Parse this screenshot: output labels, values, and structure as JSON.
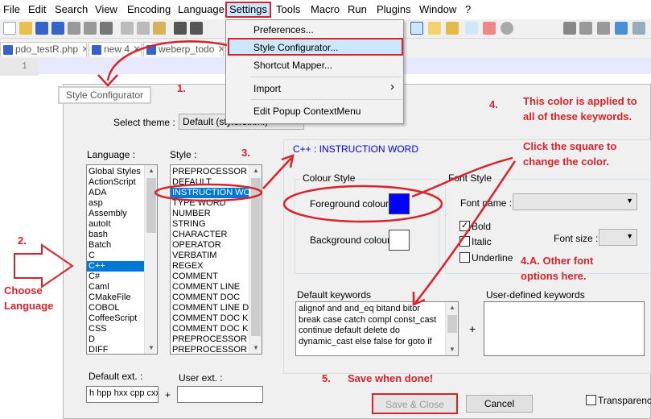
{
  "menubar": {
    "items": [
      "File",
      "Edit",
      "Search",
      "View",
      "Encoding",
      "Language",
      "Settings",
      "Tools",
      "Macro",
      "Run",
      "Plugins",
      "Window",
      "?"
    ]
  },
  "tabs": [
    {
      "label": "pdo_testR.php",
      "close": "✕"
    },
    {
      "label": "new 4",
      "close": "✕"
    },
    {
      "label": "weberp_todo",
      "close": "✕"
    }
  ],
  "editor": {
    "line_number": "1"
  },
  "settings_menu": {
    "items": [
      "Preferences...",
      "Style Configurator...",
      "Shortcut Mapper...",
      "Import",
      "Edit Popup ContextMenu"
    ],
    "submenu_arrow": "›"
  },
  "dialog": {
    "title": "Style Configurator",
    "select_theme_label": "Select theme :",
    "theme_value": "Default (stylers.xml)",
    "language_label": "Language :",
    "style_label": "Style :",
    "languages": [
      "Global Styles",
      "ActionScript",
      "ADA",
      "asp",
      "Assembly",
      "autoIt",
      "bash",
      "Batch",
      "C",
      "C++",
      "C#",
      "Caml",
      "CMakeFile",
      "COBOL",
      "CoffeeScript",
      "CSS",
      "D",
      "DIFF"
    ],
    "selected_language": "C++",
    "styles": [
      "PREPROCESSOR",
      "DEFAULT",
      "INSTRUCTION WORD",
      "TYPE WORD",
      "NUMBER",
      "STRING",
      "CHARACTER",
      "OPERATOR",
      "VERBATIM",
      "REGEX",
      "COMMENT",
      "COMMENT LINE",
      "COMMENT DOC",
      "COMMENT LINE DOC",
      "COMMENT DOC KEYWORD",
      "COMMENT DOC KEYWORD",
      "PREPROCESSOR COMMENT",
      "PREPROCESSOR COMMENT"
    ],
    "selected_style": "INSTRUCTION WORD",
    "style_heading": "C++ : INSTRUCTION WORD",
    "colour_style_label": "Colour Style",
    "foreground_label": "Foreground colour",
    "background_label": "Background colour",
    "foreground_color": "#0000ff",
    "background_color": "#ffffff",
    "font_style_label": "Font Style",
    "font_name_label": "Font name :",
    "font_size_label": "Font size :",
    "bold_label": "Bold",
    "italic_label": "Italic",
    "underline_label": "Underline",
    "bold_checked": true,
    "check_mark": "✓",
    "default_keywords_label": "Default keywords",
    "user_keywords_label": "User-defined keywords",
    "plus": "+",
    "default_keywords": [
      "alignof and and_eq bitand bitor",
      "break case catch compl const_cast",
      "continue default delete do",
      "dynamic_cast else false for goto if"
    ],
    "default_ext_label": "Default ext. :",
    "default_ext_value": "h hpp hxx cpp cxx",
    "user_ext_label": "User ext. :",
    "save_close": "Save & Close",
    "cancel": "Cancel",
    "transparency": "Transparency"
  },
  "annotations": {
    "step1": "1.",
    "step2": "2.",
    "step3": "3.",
    "step4": "4.",
    "choose_language": [
      "Choose",
      "Language"
    ],
    "color_applied": [
      "This color is applied to",
      "all of these keywords."
    ],
    "click_square": [
      "Click the square to",
      "change the color."
    ],
    "other_font": [
      "4.A. Other font",
      "options here."
    ],
    "step5": "5.",
    "save_done": "Save when done!"
  },
  "colors": {
    "annotation_red": "#d7232b",
    "selection_blue": "#0078d7"
  }
}
